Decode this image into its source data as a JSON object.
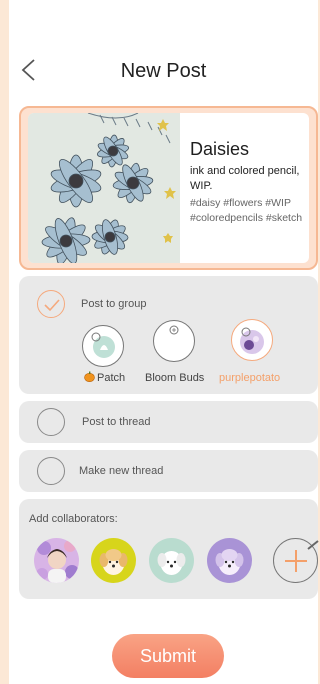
{
  "header": {
    "title": "New Post",
    "back_icon": "chevron-left-icon"
  },
  "post": {
    "title": "Daisies",
    "description": "ink and colored pencil, WIP.",
    "tags": "#daisy #flowers #WIP #coloredpencils #sketch"
  },
  "options": {
    "post_to_group": {
      "label": "Post to group",
      "checked": true
    },
    "groups": [
      {
        "name": "Patch",
        "badge_icon": "pumpkin-icon",
        "selected": false
      },
      {
        "name": "Bloom Buds",
        "selected": false
      },
      {
        "name": "purplepotato",
        "selected": true
      }
    ],
    "post_to_thread": {
      "label": "Post to thread",
      "checked": false
    },
    "make_new_thread": {
      "label": "Make new thread",
      "checked": false
    }
  },
  "collaborators": {
    "label": "Add collaborators:",
    "avatars": [
      "photo-avatar",
      "yellow-dog-avatar",
      "white-dog-avatar",
      "purple-dog-avatar"
    ],
    "add_icon": "plus-icon"
  },
  "submit_label": "Submit",
  "colors": {
    "accent": "#f5a97d",
    "panel": "#e9e9e9",
    "background": "#fce8d6",
    "submit": "#f58b6e"
  }
}
